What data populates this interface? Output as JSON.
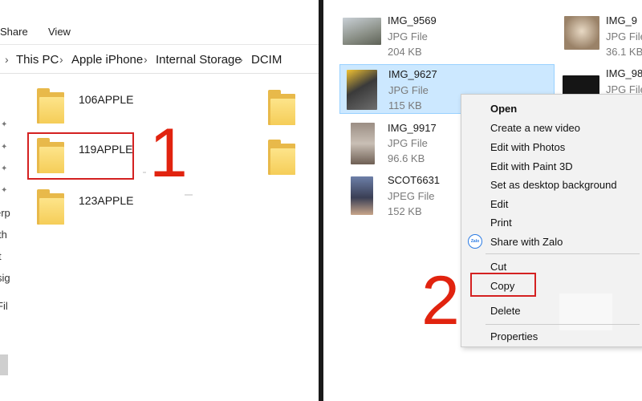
{
  "left": {
    "ribbon": {
      "share_label": "Share",
      "view_label": "View"
    },
    "breadcrumb": {
      "items": [
        "This PC",
        "Apple iPhone",
        "Internal Storage",
        "DCIM"
      ],
      "separator": "›"
    },
    "nav_fragments": [
      "erp",
      "th",
      "t",
      "sig",
      "Fil"
    ],
    "folders": [
      {
        "name": "106APPLE"
      },
      {
        "name": "119APPLE"
      },
      {
        "name": "123APPLE"
      }
    ],
    "step_label": "1"
  },
  "right": {
    "files": [
      {
        "name": "IMG_9569",
        "type": "JPG File",
        "size": "204 KB"
      },
      {
        "name": "IMG_9627",
        "type": "JPG File",
        "size": "115 KB",
        "selected": true
      },
      {
        "name": "IMG_9917",
        "type": "JPG File",
        "size": "96.6 KB"
      },
      {
        "name": "SCOT6631",
        "type": "JPEG File",
        "size": "152 KB"
      },
      {
        "name": "IMG_9",
        "type": "JPG File",
        "size": "36.1 KB"
      },
      {
        "name": "IMG_98",
        "type": "JPG File",
        "size": ""
      }
    ],
    "context_menu": {
      "items": [
        "Open",
        "Create a new video",
        "Edit with Photos",
        "Edit with Paint 3D",
        "Set as desktop background",
        "Edit",
        "Print",
        "Share with Zalo",
        "Cut",
        "Copy",
        "Delete",
        "Properties"
      ],
      "zalo_icon_text": "Zalo"
    },
    "step_label": "2"
  },
  "colors": {
    "accent_red": "#d42121",
    "selection": "#cce8ff",
    "folder_yellow": "#f5cd58"
  }
}
